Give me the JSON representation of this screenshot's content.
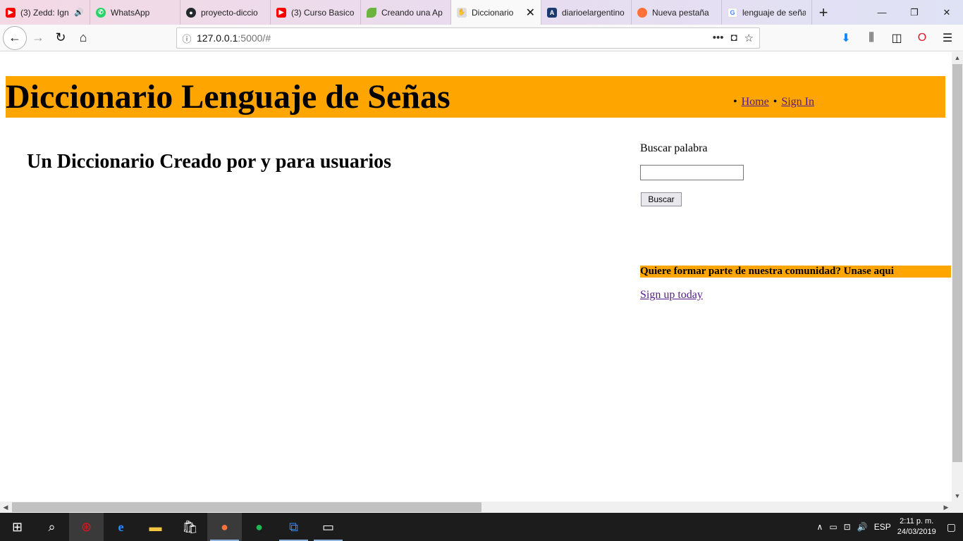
{
  "browser": {
    "tabs": [
      {
        "title": "(3) Zedd: Ign",
        "icon": "youtube-icon",
        "color": "#ff0000",
        "audio": true
      },
      {
        "title": "WhatsApp",
        "icon": "whatsapp-icon",
        "color": "#25d366"
      },
      {
        "title": "proyecto-diccio",
        "icon": "github-icon",
        "color": "#24292e"
      },
      {
        "title": "(3) Curso Basico",
        "icon": "youtube-icon",
        "color": "#ff0000"
      },
      {
        "title": "Creando una Ap",
        "icon": "leaf-icon",
        "color": "#6db33f"
      },
      {
        "title": "Diccionario",
        "icon": "page-icon",
        "color": "#999999",
        "active": true
      },
      {
        "title": "diarioelargentino",
        "icon": "diario-icon",
        "color": "#1d3a6e"
      },
      {
        "title": "Nueva pestaña",
        "icon": "firefox-icon",
        "color": "#ff7139"
      },
      {
        "title": "lenguaje de seña",
        "icon": "google-icon",
        "color": "#4285f4"
      }
    ],
    "url_host": "127.0.0.1",
    "url_path": ":5000/#"
  },
  "page": {
    "title": "Diccionario Lenguaje de Señas",
    "nav": {
      "home": "Home",
      "signin": "Sign In"
    },
    "subtitle": "Un Diccionario Creado por y para usuarios",
    "search": {
      "label": "Buscar palabra",
      "value": "",
      "button": "Buscar"
    },
    "promo": "Quiere formar parte de nuestra comunidad? Unase aqui",
    "signup": "Sign up today"
  },
  "colors": {
    "accent": "#ffa500",
    "link": "#551a8b"
  },
  "taskbar": {
    "apps": [
      "windows-start-icon",
      "search-icon",
      "app-icon",
      "edge-icon",
      "file-explorer-icon",
      "store-icon",
      "firefox-icon",
      "spotify-icon",
      "vscode-icon",
      "terminal-icon"
    ],
    "lang": "ESP",
    "time": "2:11 p. m.",
    "date": "24/03/2019"
  }
}
